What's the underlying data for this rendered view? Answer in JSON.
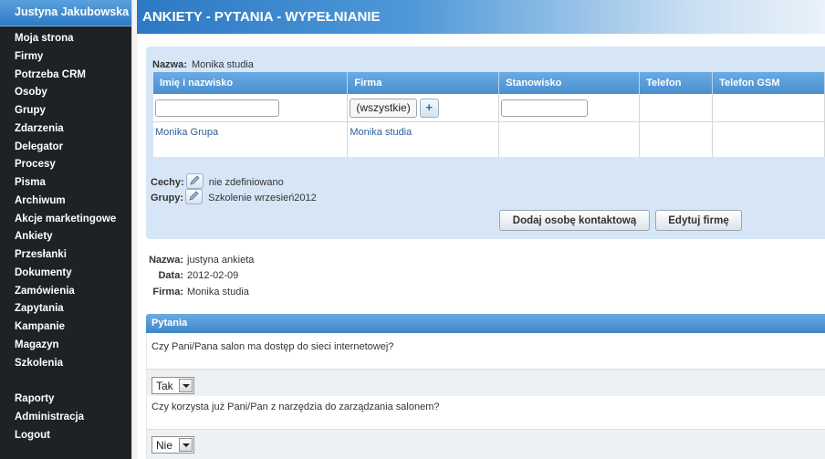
{
  "sidebar": {
    "user": "Justyna Jakubowska",
    "items": [
      "Moja strona",
      "Firmy",
      "Potrzeba CRM",
      "Osoby",
      "Grupy",
      "Zdarzenia",
      "Delegator",
      "Procesy",
      "Pisma",
      "Archiwum",
      "Akcje marketingowe",
      "Ankiety",
      "Przesłanki",
      "Dokumenty",
      "Zamówienia",
      "Zapytania",
      "Kampanie",
      "Magazyn",
      "Szkolenia"
    ],
    "items2": [
      "Raporty",
      "Administracja",
      "Logout"
    ]
  },
  "header": {
    "title": "ANKIETY - PYTANIA - WYPEŁNIANIE"
  },
  "contact": {
    "nazwa_label": "Nazwa:",
    "nazwa_value": "Monika studia",
    "columns": [
      "Imię i nazwisko",
      "Firma",
      "Stanowisko",
      "Telefon",
      "Telefon GSM"
    ],
    "filter": {
      "firma_select": "(wszystkie)",
      "plus": "+"
    },
    "row": {
      "name": "Monika Grupa",
      "firma": "Monika studia"
    },
    "cechy_label": "Cechy:",
    "cechy_value": "nie zdefiniowano",
    "grupy_label": "Grupy:",
    "grupy_value": "Szkolenie wrzesień2012",
    "btn_add_contact": "Dodaj osobę kontaktową",
    "btn_edit_firm": "Edytuj firmę"
  },
  "survey": {
    "nazwa_label": "Nazwa:",
    "nazwa_value": "justyna ankieta",
    "data_label": "Data:",
    "data_value": "2012-02-09",
    "firma_label": "Firma:",
    "firma_value": "Monika studia"
  },
  "pytania": {
    "title": "Pytania",
    "questions": [
      {
        "text": "Czy Pani/Pana salon ma dostęp do sieci internetowej?",
        "answer": "Tak"
      },
      {
        "text": "Czy korzysta już Pani/Pan z narzędzia do zarządzania salonem?",
        "answer": "Nie"
      }
    ]
  }
}
